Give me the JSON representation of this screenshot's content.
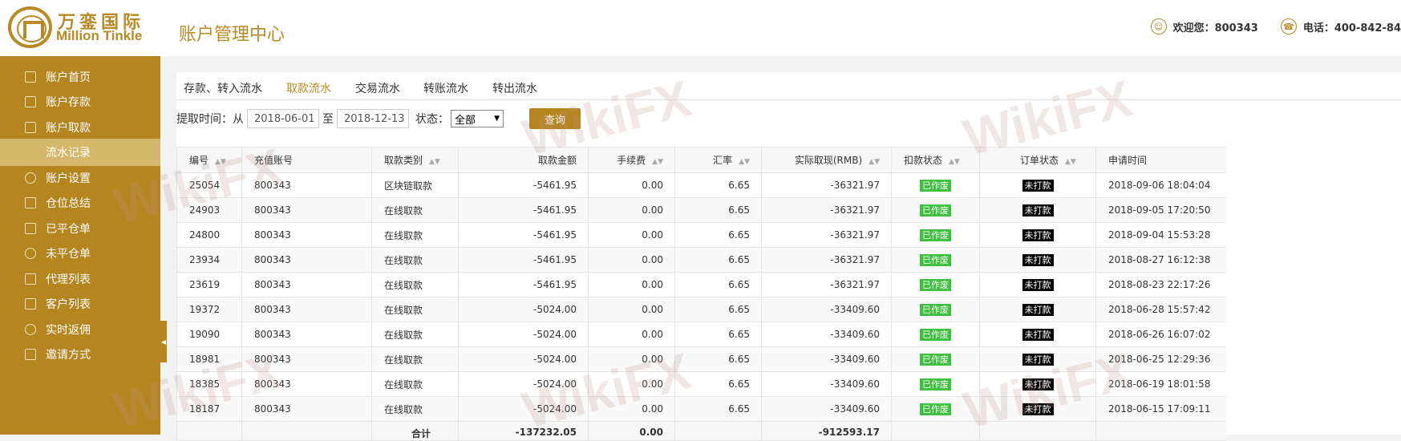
{
  "header": {
    "brand_cn": "万銮国际",
    "brand_en": "Million Tinkle",
    "page_title": "账户管理中心",
    "welcome": "欢迎您：800343",
    "phone": "电话：400-842-84"
  },
  "sidebar": {
    "items": [
      {
        "label": "账户首页",
        "icon": "home-icon"
      },
      {
        "label": "账户存款",
        "icon": "deposit-icon"
      },
      {
        "label": "账户取款",
        "icon": "withdraw-icon"
      },
      {
        "label": "流水记录",
        "icon": ""
      },
      {
        "label": "账户设置",
        "icon": "gear-icon"
      },
      {
        "label": "仓位总结",
        "icon": "summary-icon"
      },
      {
        "label": "已平仓单",
        "icon": "closed-orders-icon"
      },
      {
        "label": "未平仓单",
        "icon": "open-orders-icon"
      },
      {
        "label": "代理列表",
        "icon": "agent-list-icon"
      },
      {
        "label": "客户列表",
        "icon": "client-list-icon"
      },
      {
        "label": "实时返佣",
        "icon": "rebate-icon"
      },
      {
        "label": "邀请方式",
        "icon": "invite-icon"
      }
    ]
  },
  "tabs": [
    "存款、转入流水",
    "取款流水",
    "交易流水",
    "转账流水",
    "转出流水"
  ],
  "filter": {
    "label_from": "提取时间：从",
    "date_from": "2018-06-01",
    "label_to": "至",
    "date_to": "2018-12-13",
    "status_label": "状态：",
    "status_value": "全部",
    "query_label": "查询"
  },
  "table": {
    "headers": [
      "编号",
      "充值账号",
      "取款类别",
      "取款金额",
      "手续费",
      "汇率",
      "实际取现(RMB)",
      "扣款状态",
      "订单状态",
      "申请时间"
    ],
    "rows": [
      [
        "25054",
        "800343",
        "区块链取款",
        "-5461.95",
        "0.00",
        "6.65",
        "-36321.97",
        "已作废",
        "未打款",
        "2018-09-06 18:04:04"
      ],
      [
        "24903",
        "800343",
        "在线取款",
        "-5461.95",
        "0.00",
        "6.65",
        "-36321.97",
        "已作废",
        "未打款",
        "2018-09-05 17:20:50"
      ],
      [
        "24800",
        "800343",
        "在线取款",
        "-5461.95",
        "0.00",
        "6.65",
        "-36321.97",
        "已作废",
        "未打款",
        "2018-09-04 15:53:28"
      ],
      [
        "23934",
        "800343",
        "在线取款",
        "-5461.95",
        "0.00",
        "6.65",
        "-36321.97",
        "已作废",
        "未打款",
        "2018-08-27 16:12:38"
      ],
      [
        "23619",
        "800343",
        "在线取款",
        "-5461.95",
        "0.00",
        "6.65",
        "-36321.97",
        "已作废",
        "未打款",
        "2018-08-23 22:17:26"
      ],
      [
        "19372",
        "800343",
        "在线取款",
        "-5024.00",
        "0.00",
        "6.65",
        "-33409.60",
        "已作废",
        "未打款",
        "2018-06-28 15:57:42"
      ],
      [
        "19090",
        "800343",
        "在线取款",
        "-5024.00",
        "0.00",
        "6.65",
        "-33409.60",
        "已作废",
        "未打款",
        "2018-06-26 16:07:02"
      ],
      [
        "18981",
        "800343",
        "在线取款",
        "-5024.00",
        "0.00",
        "6.65",
        "-33409.60",
        "已作废",
        "未打款",
        "2018-06-25 12:29:36"
      ],
      [
        "18385",
        "800343",
        "在线取款",
        "-5024.00",
        "0.00",
        "6.65",
        "-33409.60",
        "已作废",
        "未打款",
        "2018-06-19 18:01:58"
      ],
      [
        "18187",
        "800343",
        "在线取款",
        "-5024.00",
        "0.00",
        "6.65",
        "-33409.60",
        "已作废",
        "未打款",
        "2018-06-15 17:09:11"
      ]
    ],
    "total": {
      "label": "合计",
      "amount": "-137232.05",
      "fee": "0.00",
      "actual": "-912593.17"
    }
  },
  "watermark": "WikiFX"
}
